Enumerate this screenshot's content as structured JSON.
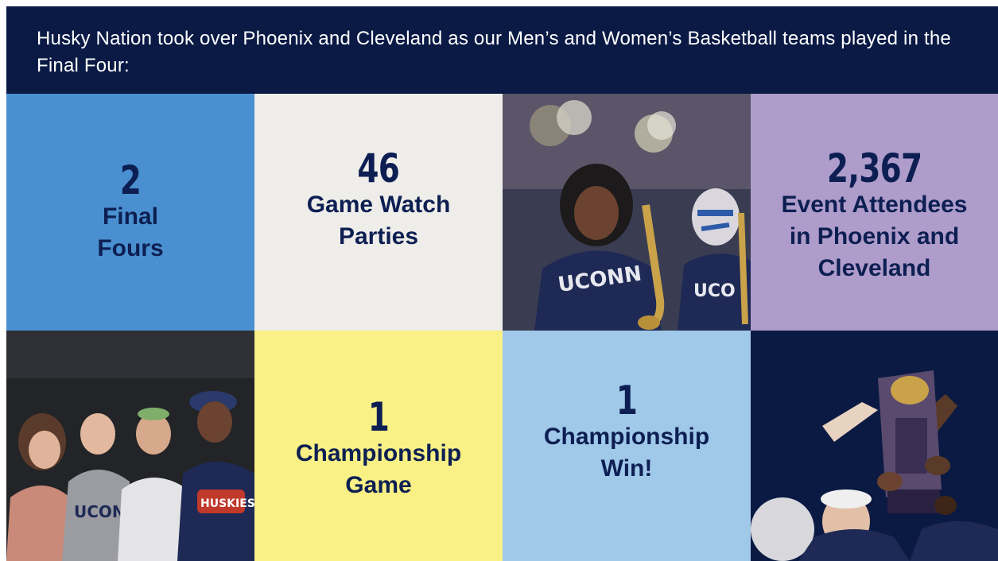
{
  "intro_text": "Husky Nation took over Phoenix and Cleveland as our Men’s and Women’s Basketball teams played in the Final Four:",
  "colors": {
    "navy": "#0a1a45",
    "tile_blue": "#4a90d0",
    "tile_offwhite": "#eeede9",
    "tile_lavender": "#ae9ccb",
    "tile_yellow": "#f9f086",
    "tile_lightblue": "#a0c8e9",
    "text_navy": "#0d1f52"
  },
  "stats": [
    {
      "number": "2",
      "label": "Final\nFours"
    },
    {
      "number": "46",
      "label": "Game Watch\nParties"
    },
    {
      "number": "2,367",
      "label": "Event Attendees\nin Phoenix and\nCleveland"
    },
    {
      "number": "1",
      "label": "Championship\nGame"
    },
    {
      "number": "1",
      "label": "Championship\nWin!"
    }
  ],
  "photos": [
    {
      "subject": "pep-band-saxophone-players"
    },
    {
      "subject": "cheering-student-fans"
    },
    {
      "subject": "ncaa-trophy-raise"
    }
  ]
}
